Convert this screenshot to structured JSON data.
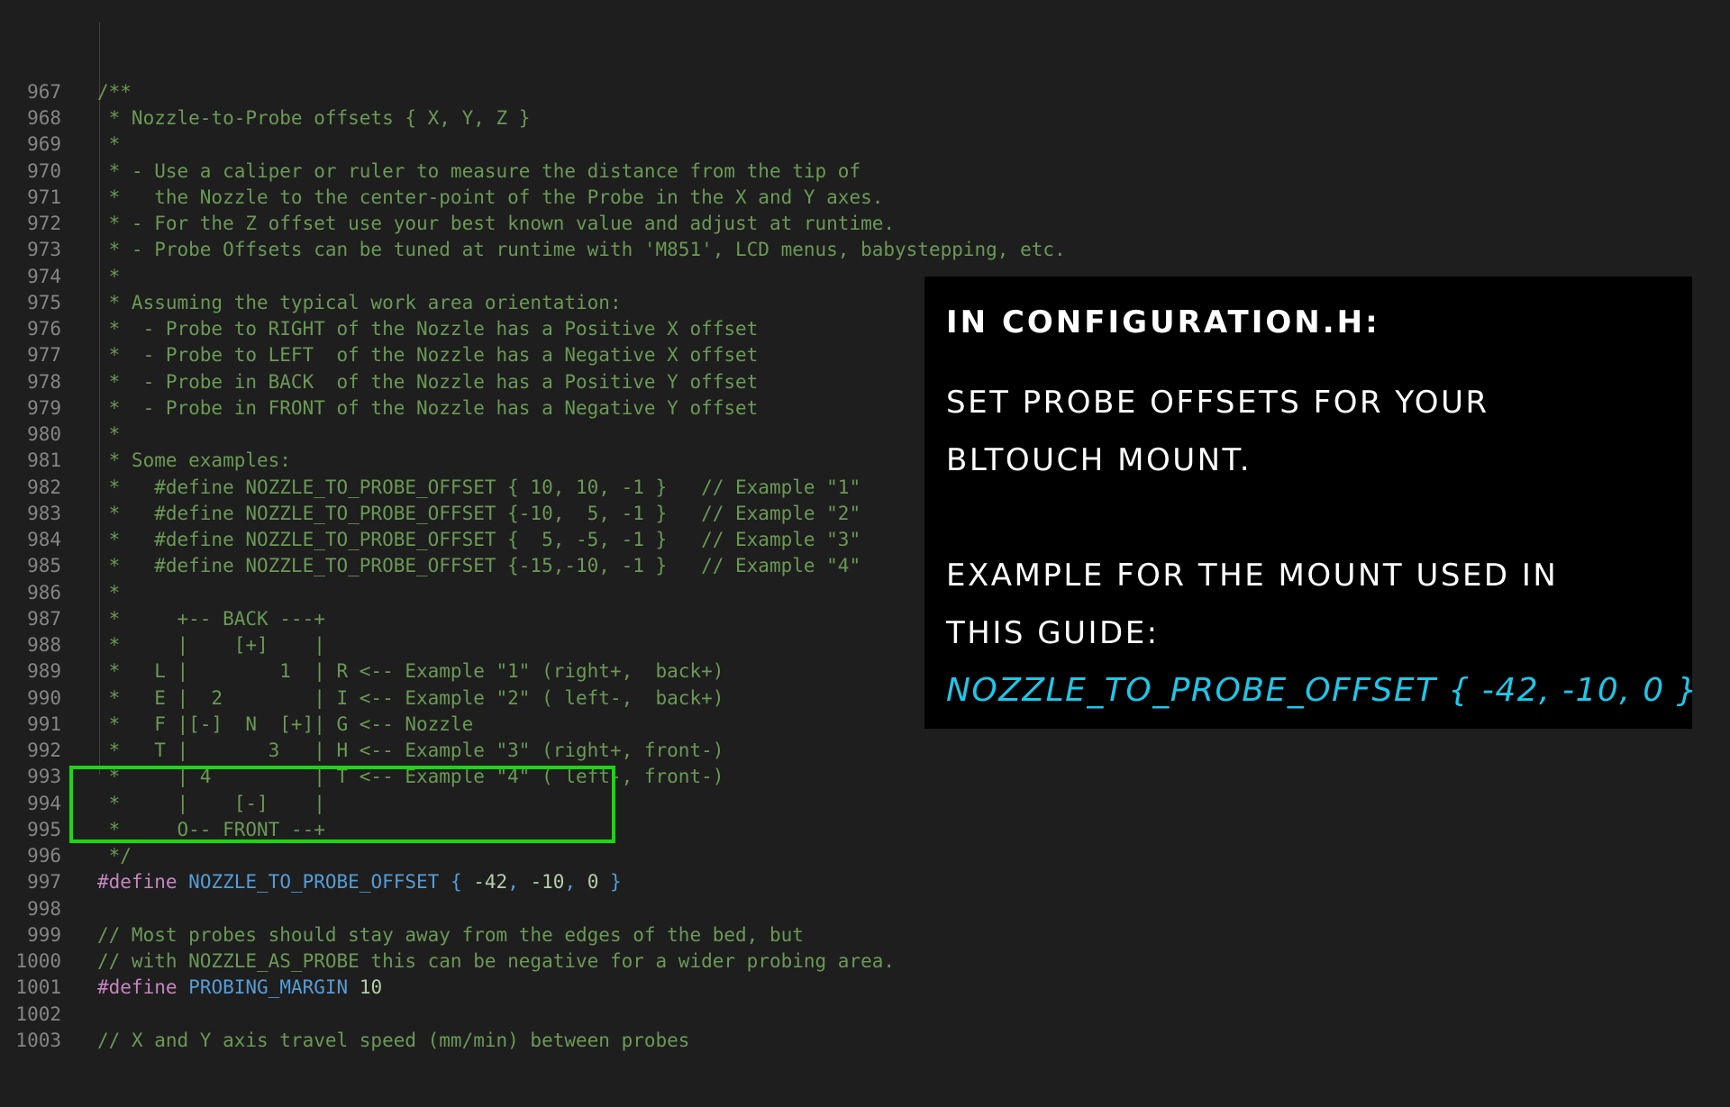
{
  "code": {
    "lines": [
      {
        "num": "967",
        "segments": [
          {
            "text": "/**",
            "style": "comment"
          }
        ]
      },
      {
        "num": "968",
        "segments": [
          {
            "text": " * Nozzle-to-Probe offsets { X, Y, Z }",
            "style": "comment"
          }
        ]
      },
      {
        "num": "969",
        "segments": [
          {
            "text": " *",
            "style": "comment"
          }
        ]
      },
      {
        "num": "970",
        "segments": [
          {
            "text": " * - Use a caliper or ruler to measure the distance from the tip of",
            "style": "comment"
          }
        ]
      },
      {
        "num": "971",
        "segments": [
          {
            "text": " *   the Nozzle to the center-point of the Probe in the X and Y axes.",
            "style": "comment"
          }
        ]
      },
      {
        "num": "972",
        "segments": [
          {
            "text": " * - For the Z offset use your best known value and adjust at runtime.",
            "style": "comment"
          }
        ]
      },
      {
        "num": "973",
        "segments": [
          {
            "text": " * - Probe Offsets can be tuned at runtime with 'M851', LCD menus, babystepping, etc.",
            "style": "comment"
          }
        ]
      },
      {
        "num": "974",
        "segments": [
          {
            "text": " *",
            "style": "comment"
          }
        ]
      },
      {
        "num": "975",
        "segments": [
          {
            "text": " * Assuming the typical work area orientation:",
            "style": "comment"
          }
        ]
      },
      {
        "num": "976",
        "segments": [
          {
            "text": " *  - Probe to RIGHT of the Nozzle has a Positive X offset",
            "style": "comment"
          }
        ]
      },
      {
        "num": "977",
        "segments": [
          {
            "text": " *  - Probe to LEFT  of the Nozzle has a Negative X offset",
            "style": "comment"
          }
        ]
      },
      {
        "num": "978",
        "segments": [
          {
            "text": " *  - Probe in BACK  of the Nozzle has a Positive Y offset",
            "style": "comment"
          }
        ]
      },
      {
        "num": "979",
        "segments": [
          {
            "text": " *  - Probe in FRONT of the Nozzle has a Negative Y offset",
            "style": "comment"
          }
        ]
      },
      {
        "num": "980",
        "segments": [
          {
            "text": " *",
            "style": "comment"
          }
        ]
      },
      {
        "num": "981",
        "segments": [
          {
            "text": " * Some examples:",
            "style": "comment"
          }
        ]
      },
      {
        "num": "982",
        "segments": [
          {
            "text": " *   #define NOZZLE_TO_PROBE_OFFSET { 10, 10, -1 }   // Example \"1\"",
            "style": "comment"
          }
        ]
      },
      {
        "num": "983",
        "segments": [
          {
            "text": " *   #define NOZZLE_TO_PROBE_OFFSET {-10,  5, -1 }   // Example \"2\"",
            "style": "comment"
          }
        ]
      },
      {
        "num": "984",
        "segments": [
          {
            "text": " *   #define NOZZLE_TO_PROBE_OFFSET {  5, -5, -1 }   // Example \"3\"",
            "style": "comment"
          }
        ]
      },
      {
        "num": "985",
        "segments": [
          {
            "text": " *   #define NOZZLE_TO_PROBE_OFFSET {-15,-10, -1 }   // Example \"4\"",
            "style": "comment"
          }
        ]
      },
      {
        "num": "986",
        "segments": [
          {
            "text": " *",
            "style": "comment"
          }
        ]
      },
      {
        "num": "987",
        "segments": [
          {
            "text": " *     +-- BACK ---+",
            "style": "comment"
          }
        ]
      },
      {
        "num": "988",
        "segments": [
          {
            "text": " *     |    [+]    |",
            "style": "comment"
          }
        ]
      },
      {
        "num": "989",
        "segments": [
          {
            "text": " *   L |        1  | R <-- Example \"1\" (right+,  back+)",
            "style": "comment"
          }
        ]
      },
      {
        "num": "990",
        "segments": [
          {
            "text": " *   E |  2        | I <-- Example \"2\" ( left-,  back+)",
            "style": "comment"
          }
        ]
      },
      {
        "num": "991",
        "segments": [
          {
            "text": " *   F |[-]  N  [+]| G <-- Nozzle",
            "style": "comment"
          }
        ]
      },
      {
        "num": "992",
        "segments": [
          {
            "text": " *   T |       3   | H <-- Example \"3\" (right+, front-)",
            "style": "comment"
          }
        ]
      },
      {
        "num": "993",
        "segments": [
          {
            "text": " *     | 4         | T <-- Example \"4\" ( left-, front-)",
            "style": "comment"
          }
        ]
      },
      {
        "num": "994",
        "segments": [
          {
            "text": " *     |    [-]    |",
            "style": "comment"
          }
        ]
      },
      {
        "num": "995",
        "segments": [
          {
            "text": " *     O-- FRONT --+",
            "style": "comment"
          }
        ]
      },
      {
        "num": "996",
        "segments": [
          {
            "text": " */",
            "style": "comment"
          }
        ]
      },
      {
        "num": "997",
        "segments": [
          {
            "text": "#define",
            "style": "directive"
          },
          {
            "text": " ",
            "style": "plain"
          },
          {
            "text": "NOZZLE_TO_PROBE_OFFSET",
            "style": "macro"
          },
          {
            "text": " { ",
            "style": "macro"
          },
          {
            "text": "-42",
            "style": "number"
          },
          {
            "text": ", ",
            "style": "macro"
          },
          {
            "text": "-10",
            "style": "number"
          },
          {
            "text": ", ",
            "style": "macro"
          },
          {
            "text": "0",
            "style": "number"
          },
          {
            "text": " }",
            "style": "macro"
          }
        ]
      },
      {
        "num": "998",
        "segments": []
      },
      {
        "num": "999",
        "segments": [
          {
            "text": "// Most probes should stay away from the edges of the bed, but",
            "style": "comment"
          }
        ]
      },
      {
        "num": "1000",
        "segments": [
          {
            "text": "// with NOZZLE_AS_PROBE this can be negative for a wider probing area.",
            "style": "comment"
          }
        ]
      },
      {
        "num": "1001",
        "segments": [
          {
            "text": "#define",
            "style": "directive"
          },
          {
            "text": " ",
            "style": "plain"
          },
          {
            "text": "PROBING_MARGIN",
            "style": "macro"
          },
          {
            "text": " ",
            "style": "plain"
          },
          {
            "text": "10",
            "style": "number"
          }
        ]
      },
      {
        "num": "1002",
        "segments": []
      },
      {
        "num": "1003",
        "segments": [
          {
            "text": "// X and Y axis travel speed (mm/min) between probes",
            "style": "comment"
          }
        ]
      }
    ]
  },
  "overlay": {
    "heading": "IN CONFIGURATION.H:",
    "line1": "SET PROBE OFFSETS FOR YOUR",
    "line2": "BLTOUCH MOUNT.",
    "line3": "EXAMPLE FOR THE MOUNT USED IN",
    "line4": "THIS GUIDE:",
    "code": "NOZZLE_TO_PROBE_OFFSET { -42, -10, 0 }"
  },
  "colors": {
    "background": "#1e1e1e",
    "comment": "#6a9955",
    "directive": "#c586c0",
    "macro": "#569cd6",
    "number": "#b5cea8",
    "line_number": "#858585",
    "highlight_box": "#19d80f",
    "overlay_code": "#1cc8ea"
  }
}
